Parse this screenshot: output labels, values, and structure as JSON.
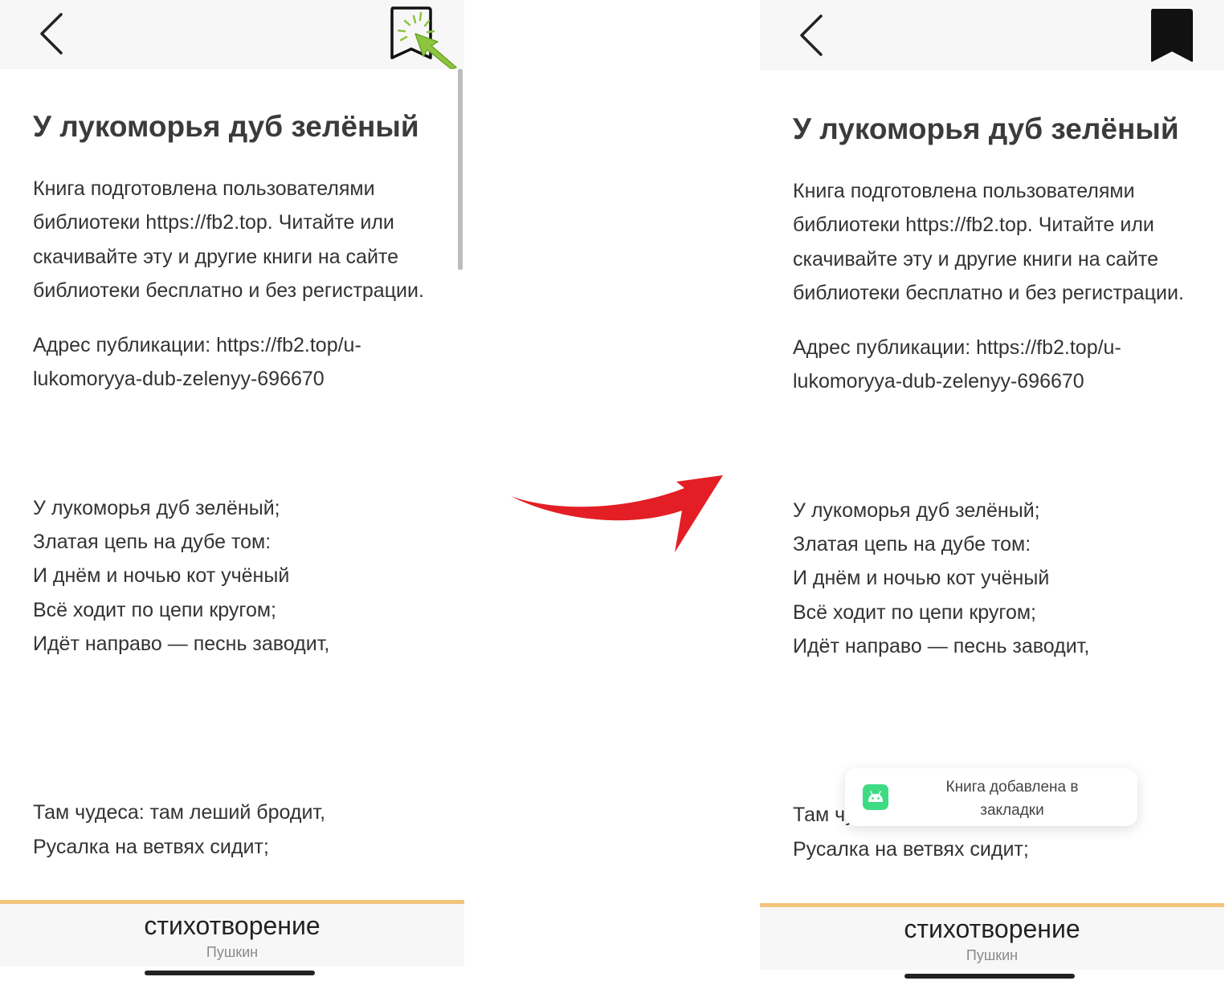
{
  "book": {
    "title": "У лукоморья дуб зелёный",
    "intro": "Книга подготовлена пользователями библиотеки https://fb2.top. Читайте или скачивайте эту и другие книги на сайте библиотеки бесплатно и без регистрации.",
    "address": "Адрес публикации: https://fb2.top/u-lukomoryya-dub-zelenyy-696670",
    "stanza_lines": [
      "У лукоморья дуб зелёный;",
      "Златая цепь на дубе том:",
      "И днём и ночью кот учёный",
      "Всё ходит по цепи кругом;",
      "Идёт направо — песнь заводит,"
    ],
    "stanza2_lines": [
      "Там чудеса: там леший бродит,",
      "Русалка на ветвях сидит;"
    ]
  },
  "bottom_bar": {
    "title": "стихотворение",
    "author": "Пушкин"
  },
  "toast": {
    "line1": "Книга добавлена в",
    "line2": "закладки"
  },
  "icons": {
    "back": "chevron-left-icon",
    "bookmark_before": "bookmark-outline-icon",
    "bookmark_after": "bookmark-filled-icon",
    "cursor": "pointer-arrow-icon",
    "toast": "android-icon",
    "transition": "curved-arrow-icon"
  },
  "colors": {
    "accent_line": "#f2c47b",
    "cursor_green": "#8cc63f",
    "arrow_red": "#e31e24",
    "android_green": "#3ddc84"
  }
}
